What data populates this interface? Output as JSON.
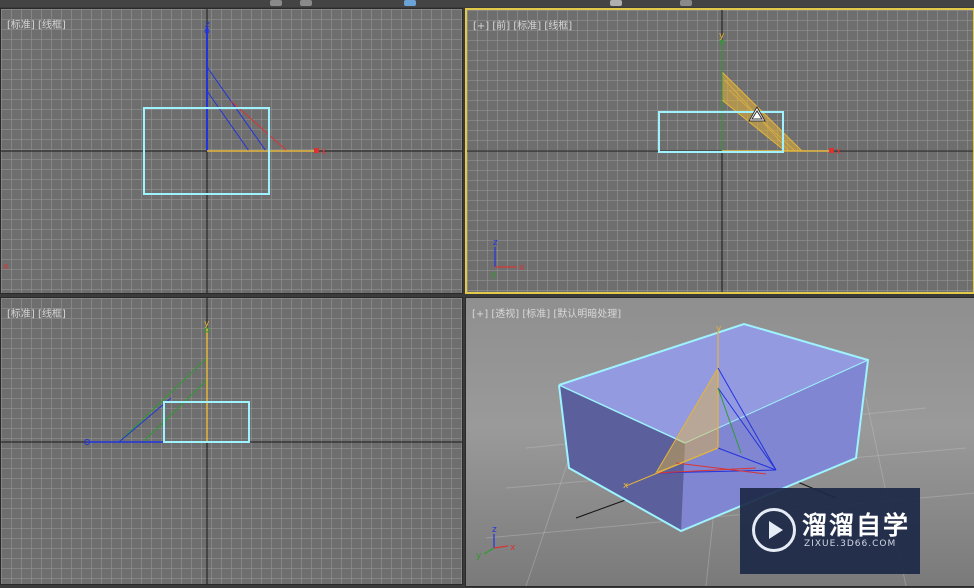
{
  "viewports": {
    "top": {
      "label": "[标准] [线框]"
    },
    "front": {
      "label": "[+] [前] [标准] [线框]"
    },
    "left": {
      "label": "[标准] [线框]"
    },
    "perspective": {
      "label": "[+] [透视] [标准] [默认明暗处理]"
    }
  },
  "axes": {
    "x": "x",
    "y": "y",
    "z": "z"
  },
  "colors": {
    "active_border": "#e3c94a",
    "selection": "#9ef3ff",
    "x_axis": "#d93434",
    "y_axis": "#2f9b2f",
    "z_axis": "#2233dd",
    "gizmo_yellow": "#e5b53b",
    "box_face": "#8d93dc"
  },
  "watermark": {
    "title": "溜溜自学",
    "subtitle": "ZIXUE.3D66.COM"
  }
}
